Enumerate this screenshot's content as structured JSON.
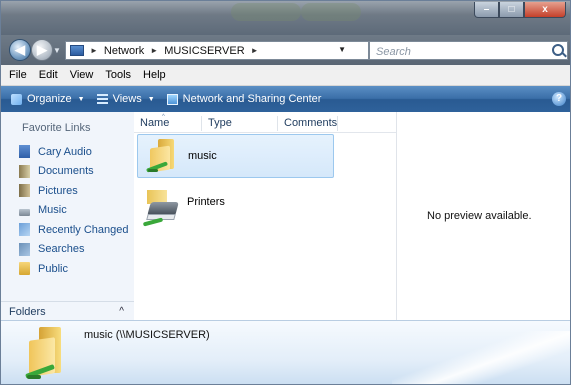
{
  "window": {
    "controls": {
      "minimize": "–",
      "maximize": "□",
      "close": "x"
    }
  },
  "address": {
    "crumbs": [
      "Network",
      "MUSICSERVER"
    ],
    "separator": "►",
    "dropdown": "▼",
    "refresh": "↔",
    "search_placeholder": "Search"
  },
  "nav": {
    "back": "◀",
    "forward": "▶",
    "history_dropdown": "▼"
  },
  "menu": {
    "items": [
      "File",
      "Edit",
      "View",
      "Tools",
      "Help"
    ]
  },
  "command_bar": {
    "organize": "Organize",
    "views": "Views",
    "network_center": "Network and Sharing Center",
    "arrow": "▼",
    "help": "?"
  },
  "nav_pane": {
    "title": "Favorite Links",
    "links": [
      "Cary Audio",
      "Documents",
      "Pictures",
      "Music",
      "Recently Changed",
      "Searches",
      "Public"
    ],
    "folders_label": "Folders",
    "folders_chevron": "^"
  },
  "columns": {
    "name": "Name",
    "type": "Type",
    "comments": "Comments",
    "sort_indicator": "^"
  },
  "items": [
    {
      "name": "music",
      "icon": "network-folder-icon",
      "selected": true
    },
    {
      "name": "Printers",
      "icon": "printer-icon",
      "selected": false
    }
  ],
  "preview": {
    "message": "No preview available."
  },
  "details": {
    "name": "music (\\\\MUSICSERVER)"
  }
}
